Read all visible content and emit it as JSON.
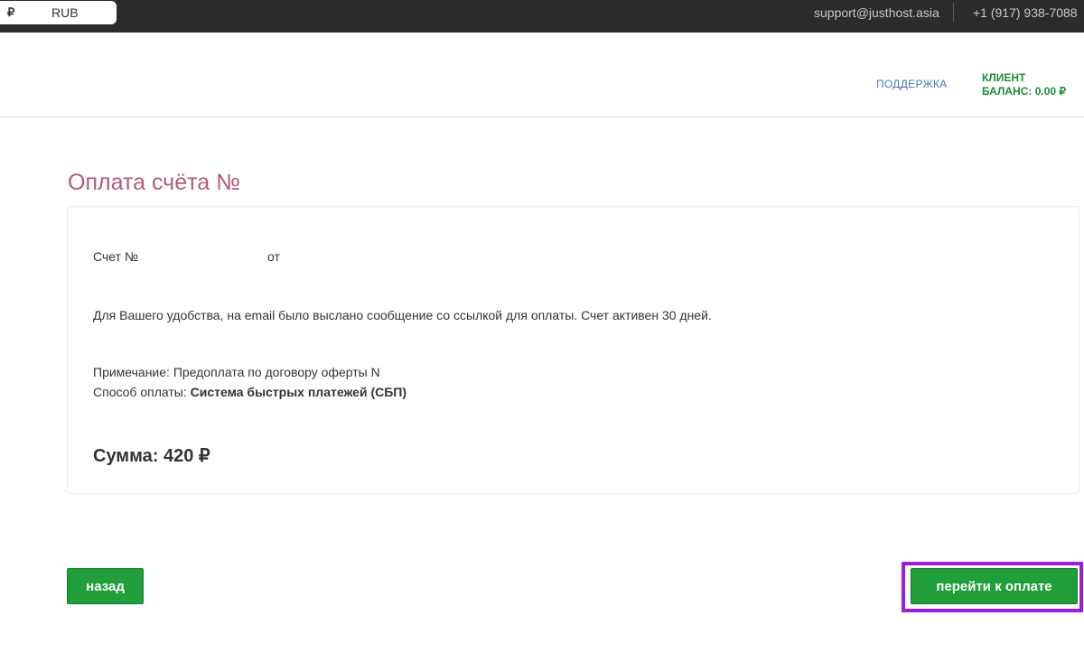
{
  "topbar": {
    "currency_symbol": "₽",
    "currency_code": "RUB",
    "email": "support@justhost.asia",
    "phone": "+1 (917) 938-7088"
  },
  "header": {
    "support_label": "ПОДДЕРЖКА",
    "client_label": "КЛИЕНТ",
    "balance_label": "БАЛАНС: 0.00 ₽"
  },
  "page": {
    "title": "Оплата счёта №"
  },
  "invoice": {
    "number_label": "Счет №",
    "from_label": "от",
    "info_text": "Для Вашего удобства, на email было выслано сообщение со ссылкой для оплаты. Счет активен 30 дней.",
    "note": "Примечание: Предоплата по договору оферты N",
    "method_label": "Способ оплаты: ",
    "method_value": "Система быстрых платежей (СБП)",
    "sum": "Сумма: 420 ₽"
  },
  "actions": {
    "back_label": "назад",
    "pay_label": "перейти к оплате"
  },
  "colors": {
    "accent_green": "#1f9e3a",
    "title_pink": "#b35a7a",
    "highlight_purple": "#9b1ee0",
    "topbar_bg": "#2b2b2b"
  }
}
